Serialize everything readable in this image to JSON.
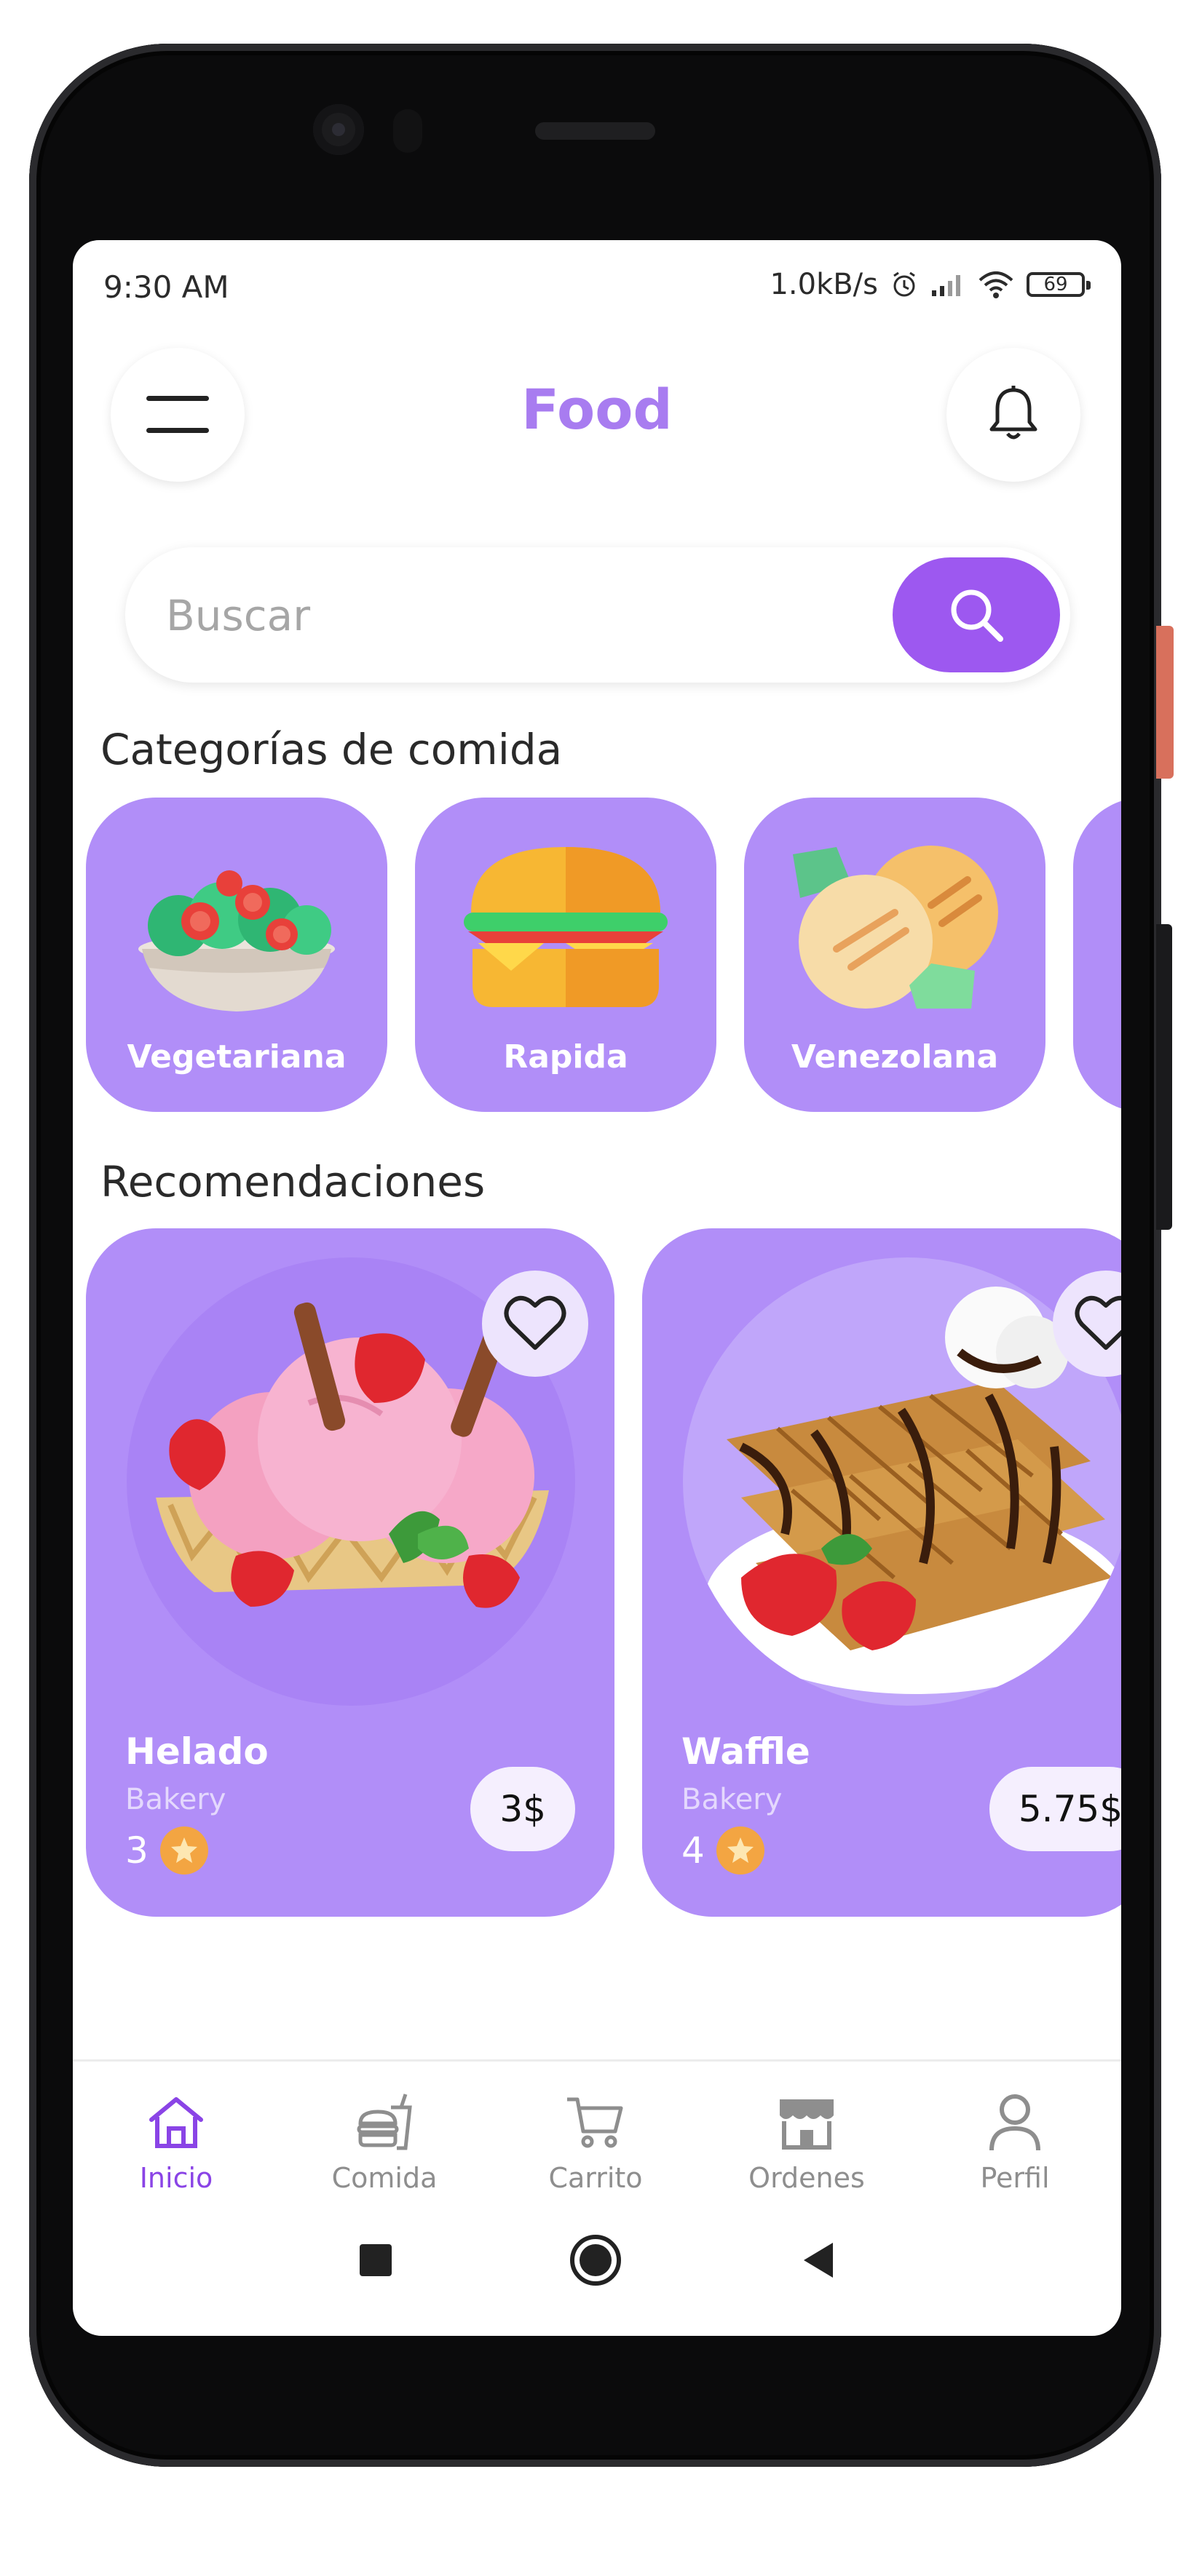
{
  "status_bar": {
    "time": "9:30 AM",
    "speed": "1.0kB/s",
    "battery": "69"
  },
  "header": {
    "title": "Food",
    "menu_icon": "menu-icon",
    "bell_icon": "bell-icon"
  },
  "search": {
    "placeholder": "Buscar",
    "value": "",
    "icon": "search-icon"
  },
  "categories": {
    "title": "Categorías de comida",
    "items": [
      {
        "label": "Vegetariana",
        "icon": "salad-icon"
      },
      {
        "label": "Rapida",
        "icon": "burger-icon"
      },
      {
        "label": "Venezolana",
        "icon": "arepa-icon"
      }
    ]
  },
  "recommendations": {
    "title": "Recomendaciones",
    "items": [
      {
        "name": "Helado",
        "category": "Bakery",
        "rating": "3",
        "price": "3$"
      },
      {
        "name": "Waffle",
        "category": "Bakery",
        "rating": "4",
        "price": "5.75$"
      }
    ]
  },
  "bottom_nav": {
    "items": [
      {
        "label": "Inicio",
        "icon": "home-icon",
        "active": true
      },
      {
        "label": "Comida",
        "icon": "food-icon",
        "active": false
      },
      {
        "label": "Carrito",
        "icon": "cart-icon",
        "active": false
      },
      {
        "label": "Ordenes",
        "icon": "store-icon",
        "active": false
      },
      {
        "label": "Perfil",
        "icon": "user-icon",
        "active": false
      }
    ]
  },
  "colors": {
    "accent": "#9d58f0",
    "card": "#b18ef8",
    "title": "#a87cf0",
    "star": "#f3a542"
  }
}
